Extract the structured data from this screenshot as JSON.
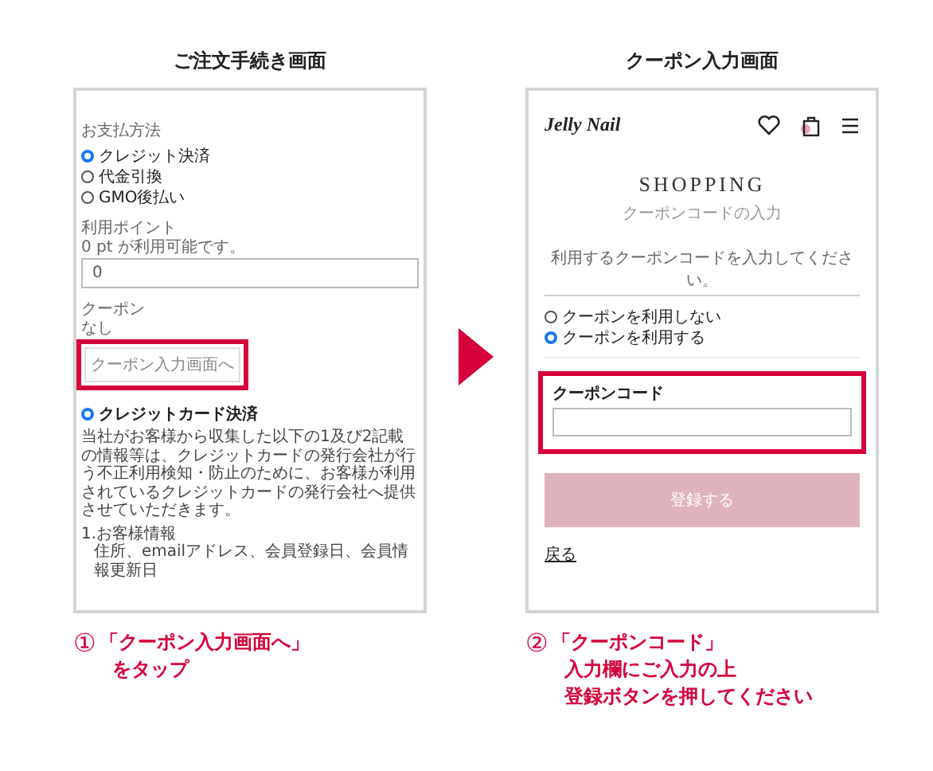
{
  "left_screen": {
    "title": "ご注文手続き画面",
    "payment_label": "お支払方法",
    "payment_methods": [
      {
        "label": "クレジット決済",
        "selected": true
      },
      {
        "label": "代金引換",
        "selected": false
      },
      {
        "label": "GMO後払い",
        "selected": false
      }
    ],
    "points_label": "利用ポイント",
    "points_note": "0 pt が利用可能です。",
    "points_value": "0",
    "coupon_label": "クーポン",
    "coupon_status": "なし",
    "coupon_button": "クーポン入力画面へ",
    "card_option": {
      "label": "クレジットカード決済",
      "selected": true
    },
    "card_notice": "当社がお客様から収集した以下の1及び2記載の情報等は、クレジットカードの発行会社が行う不正利用検知・防止のために、お客様が利用されているクレジットカードの発行会社へ提供させていただきます。",
    "info_heading": "1.お客様情報",
    "info_detail": "住所、emailアドレス、会員登録日、会員情報更新日"
  },
  "right_screen": {
    "title": "クーポン入力画面",
    "logo": "Jelly Nail",
    "heading": "SHOPPING",
    "subheading": "クーポンコードの入力",
    "instruction": "利用するクーポンコードを入力してください。",
    "coupon_options": [
      {
        "label": "クーポンを利用しない",
        "selected": false
      },
      {
        "label": "クーポンを利用する",
        "selected": true
      }
    ],
    "code_label": "クーポンコード",
    "register_button": "登録する",
    "back_link": "戻る"
  },
  "steps": [
    {
      "number": "①",
      "lines": [
        "「クーポン入力画面へ」",
        "をタップ"
      ]
    },
    {
      "number": "②",
      "lines": [
        "「クーポンコード」",
        "入力欄にご入力の上",
        "登録ボタンを押してください"
      ]
    }
  ]
}
